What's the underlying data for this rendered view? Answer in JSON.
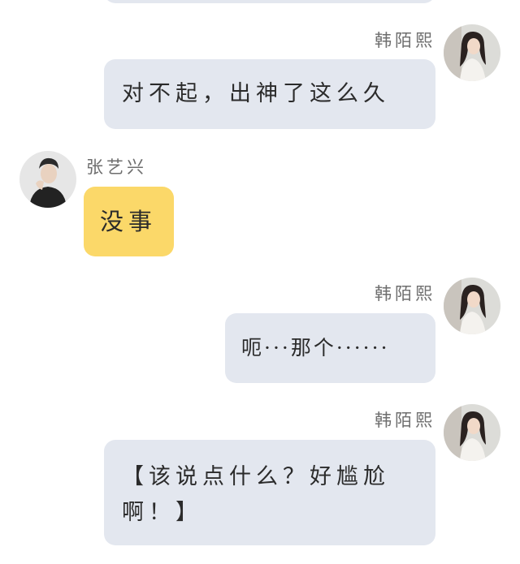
{
  "chat": {
    "messages": [
      {
        "sender": "韩陌熙",
        "side": "right",
        "text": "对不起，出神了这么久"
      },
      {
        "sender": "张艺兴",
        "side": "left",
        "text": "没事"
      },
      {
        "sender": "韩陌熙",
        "side": "right",
        "text": "呃···那个······"
      },
      {
        "sender": "韩陌熙",
        "side": "right",
        "text": "【该说点什么？好尴尬啊！】"
      }
    ]
  },
  "colors": {
    "right_bubble": "#e3e7ef",
    "left_bubble": "#fbd869"
  },
  "avatars": {
    "right": "female-avatar",
    "left": "male-avatar"
  }
}
